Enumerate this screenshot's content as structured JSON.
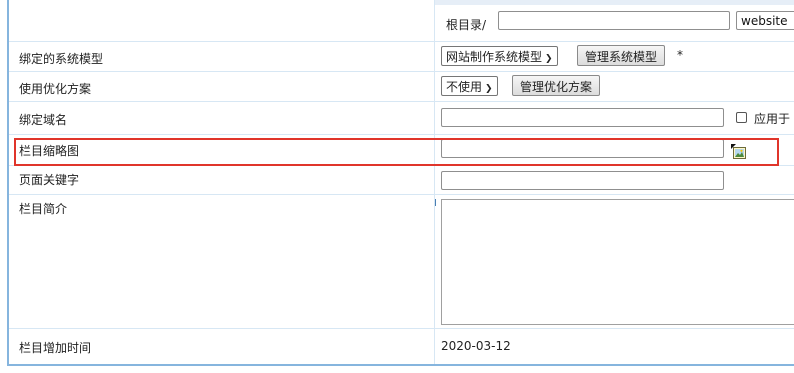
{
  "root_dir": {
    "label": "根目录/",
    "value": "",
    "website_value": "website"
  },
  "bound_model": {
    "label": "绑定的系统模型",
    "selected": "网站制作系统模型",
    "manage_button": "管理系统模型",
    "required_mark": "*"
  },
  "optimization": {
    "label": "使用优化方案",
    "selected": "不使用",
    "manage_button": "管理优化方案"
  },
  "domain": {
    "label": "绑定域名",
    "value": "",
    "apply_checkbox_label": "应用于"
  },
  "thumbnail": {
    "label": "栏目缩略图",
    "value": "",
    "image_icon": "image-icon"
  },
  "keywords": {
    "label": "页面关键字",
    "value": ""
  },
  "intro": {
    "label": "栏目简介",
    "value": ""
  },
  "added_time": {
    "label": "栏目增加时间",
    "value": "2020-03-12"
  },
  "colors": {
    "border_blue": "#86b5de",
    "row_line": "#d7e7f4",
    "highlight_red": "#e0352b"
  }
}
